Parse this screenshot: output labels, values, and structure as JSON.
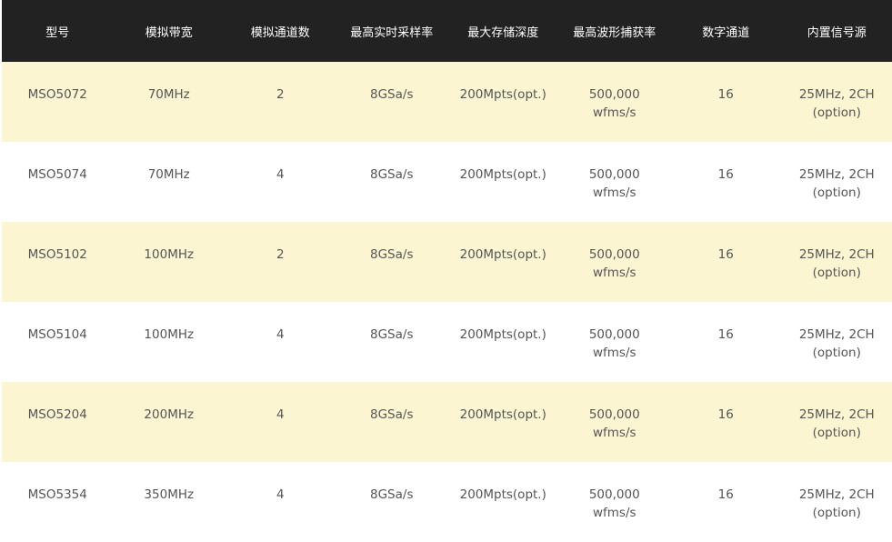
{
  "table": {
    "headers": [
      "型号",
      "模拟带宽",
      "模拟通道数",
      "最高实时采样率",
      "最大存储深度",
      "最高波形捕获率",
      "数字通道",
      "内置信号源"
    ],
    "rows": [
      {
        "model": "MSO5072",
        "bandwidth": "70MHz",
        "channels": "2",
        "sample_rate": "8GSa/s",
        "memory_depth": "200Mpts(opt.)",
        "capture_rate_line1": "500,000",
        "capture_rate_line2": "wfms/s",
        "digital_channels": "16",
        "signal_source_line1": "25MHz, 2CH",
        "signal_source_line2": "(option)"
      },
      {
        "model": "MSO5074",
        "bandwidth": "70MHz",
        "channels": "4",
        "sample_rate": "8GSa/s",
        "memory_depth": "200Mpts(opt.)",
        "capture_rate_line1": "500,000",
        "capture_rate_line2": "wfms/s",
        "digital_channels": "16",
        "signal_source_line1": "25MHz, 2CH",
        "signal_source_line2": "(option)"
      },
      {
        "model": "MSO5102",
        "bandwidth": "100MHz",
        "channels": "2",
        "sample_rate": "8GSa/s",
        "memory_depth": "200Mpts(opt.)",
        "capture_rate_line1": "500,000",
        "capture_rate_line2": "wfms/s",
        "digital_channels": "16",
        "signal_source_line1": "25MHz, 2CH",
        "signal_source_line2": "(option)"
      },
      {
        "model": "MSO5104",
        "bandwidth": "100MHz",
        "channels": "4",
        "sample_rate": "8GSa/s",
        "memory_depth": "200Mpts(opt.)",
        "capture_rate_line1": "500,000",
        "capture_rate_line2": "wfms/s",
        "digital_channels": "16",
        "signal_source_line1": "25MHz, 2CH",
        "signal_source_line2": "(option)"
      },
      {
        "model": "MSO5204",
        "bandwidth": "200MHz",
        "channels": "4",
        "sample_rate": "8GSa/s",
        "memory_depth": "200Mpts(opt.)",
        "capture_rate_line1": "500,000",
        "capture_rate_line2": "wfms/s",
        "digital_channels": "16",
        "signal_source_line1": "25MHz, 2CH",
        "signal_source_line2": "(option)"
      },
      {
        "model": "MSO5354",
        "bandwidth": "350MHz",
        "channels": "4",
        "sample_rate": "8GSa/s",
        "memory_depth": "200Mpts(opt.)",
        "capture_rate_line1": "500,000",
        "capture_rate_line2": "wfms/s",
        "digital_channels": "16",
        "signal_source_line1": "25MHz, 2CH",
        "signal_source_line2": "(option)"
      }
    ]
  },
  "colors": {
    "header_background": "#222222",
    "header_text": "#ffffff",
    "odd_row_background": "#fcf5d2",
    "even_row_background": "#ffffff",
    "body_text": "#555555"
  }
}
